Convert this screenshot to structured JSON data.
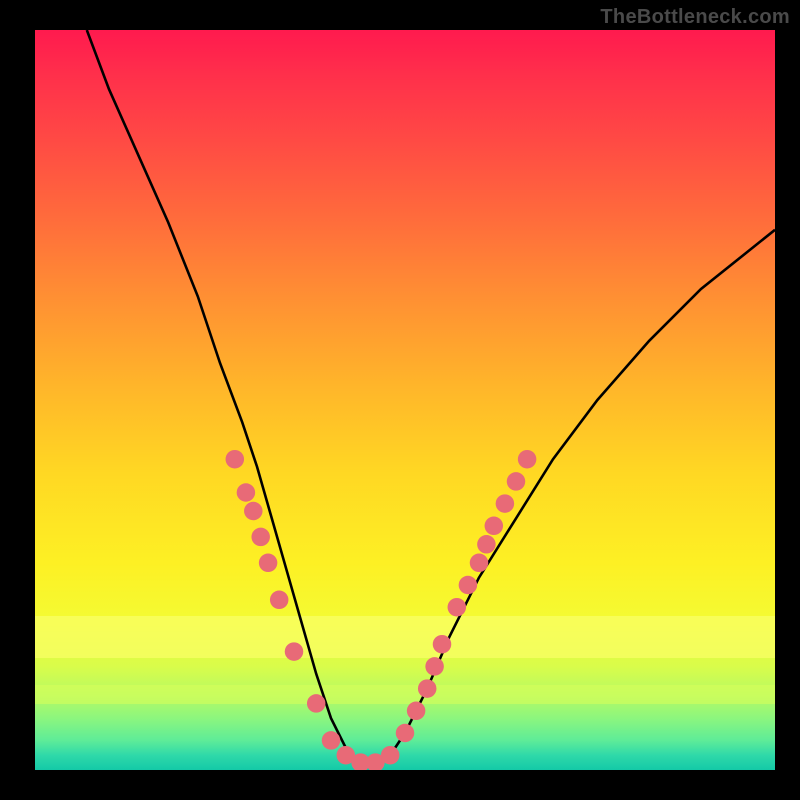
{
  "watermark": "TheBottleneck.com",
  "chart_data": {
    "type": "line",
    "title": "",
    "xlabel": "",
    "ylabel": "",
    "xlim": [
      0,
      100
    ],
    "ylim": [
      0,
      100
    ],
    "grid": false,
    "series": [
      {
        "name": "curve",
        "x": [
          7,
          10,
          14,
          18,
          22,
          25,
          28,
          30,
          32,
          34,
          36,
          38,
          40,
          42,
          44,
          46,
          48,
          50,
          53,
          56,
          60,
          65,
          70,
          76,
          83,
          90,
          100
        ],
        "y": [
          100,
          92,
          83,
          74,
          64,
          55,
          47,
          41,
          34,
          27,
          20,
          13,
          7,
          3,
          1,
          1,
          2,
          5,
          11,
          18,
          26,
          34,
          42,
          50,
          58,
          65,
          73
        ]
      }
    ],
    "markers": [
      {
        "x": 27.0,
        "y": 42.0
      },
      {
        "x": 28.5,
        "y": 37.5
      },
      {
        "x": 29.5,
        "y": 35.0
      },
      {
        "x": 30.5,
        "y": 31.5
      },
      {
        "x": 31.5,
        "y": 28.0
      },
      {
        "x": 33.0,
        "y": 23.0
      },
      {
        "x": 35.0,
        "y": 16.0
      },
      {
        "x": 38.0,
        "y": 9.0
      },
      {
        "x": 40.0,
        "y": 4.0
      },
      {
        "x": 42.0,
        "y": 2.0
      },
      {
        "x": 44.0,
        "y": 1.0
      },
      {
        "x": 46.0,
        "y": 1.0
      },
      {
        "x": 48.0,
        "y": 2.0
      },
      {
        "x": 50.0,
        "y": 5.0
      },
      {
        "x": 51.5,
        "y": 8.0
      },
      {
        "x": 53.0,
        "y": 11.0
      },
      {
        "x": 54.0,
        "y": 14.0
      },
      {
        "x": 55.0,
        "y": 17.0
      },
      {
        "x": 57.0,
        "y": 22.0
      },
      {
        "x": 58.5,
        "y": 25.0
      },
      {
        "x": 60.0,
        "y": 28.0
      },
      {
        "x": 61.0,
        "y": 30.5
      },
      {
        "x": 62.0,
        "y": 33.0
      },
      {
        "x": 63.5,
        "y": 36.0
      },
      {
        "x": 65.0,
        "y": 39.0
      },
      {
        "x": 66.5,
        "y": 42.0
      }
    ],
    "background_gradient": {
      "top": "#ff1a4e",
      "bottom": "#14c9a7"
    }
  }
}
